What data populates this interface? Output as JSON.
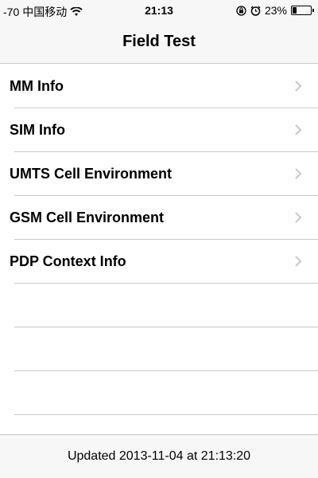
{
  "status_bar": {
    "signal": "-70",
    "carrier": "中国移动",
    "time": "21:13",
    "battery_percent": "23%",
    "battery_level": 0.23,
    "icons": [
      "wifi-icon",
      "rotation-lock-icon",
      "alarm-icon",
      "battery-icon"
    ]
  },
  "nav": {
    "title": "Field Test"
  },
  "list": {
    "items": [
      {
        "label": "MM Info"
      },
      {
        "label": "SIM Info"
      },
      {
        "label": "UMTS Cell Environment"
      },
      {
        "label": "GSM Cell Environment"
      },
      {
        "label": "PDP Context Info"
      }
    ]
  },
  "footer": {
    "updated_text": "Updated 2013-11-04 at 21:13:20"
  },
  "colors": {
    "separator": "#c8c7cc",
    "chevron": "#c7c7cc",
    "bar_bg": "#f7f7f7"
  }
}
